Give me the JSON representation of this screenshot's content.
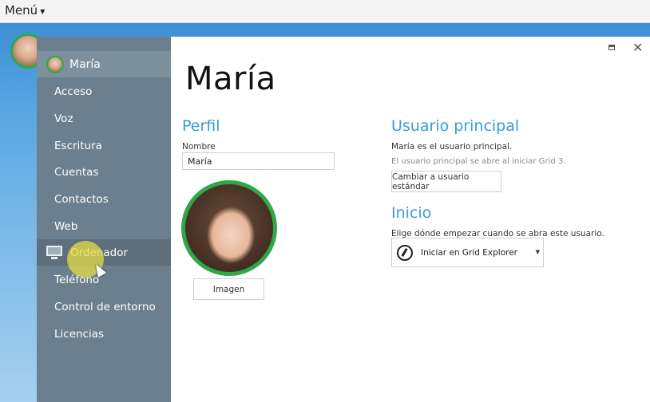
{
  "menubar": {
    "menu_label": "Menú"
  },
  "sidebar": {
    "user_name": "María",
    "items": [
      {
        "label": "Acceso"
      },
      {
        "label": "Voz"
      },
      {
        "label": "Escritura"
      },
      {
        "label": "Cuentas"
      },
      {
        "label": "Contactos"
      },
      {
        "label": "Web"
      },
      {
        "label": "Ordenador",
        "icon": "monitor-icon",
        "active": true
      },
      {
        "label": "Teléfono"
      },
      {
        "label": "Control de entorno"
      },
      {
        "label": "Licencias"
      }
    ]
  },
  "panel": {
    "title": "María",
    "profile": {
      "heading": "Perfil",
      "name_label": "Nombre",
      "name_value": "María",
      "image_button": "Imagen"
    },
    "main_user": {
      "heading": "Usuario principal",
      "status": "María es el usuario principal.",
      "note": "El usuario principal se abre al iniciar Grid 3.",
      "change_button": "Cambiar a usuario estándar"
    },
    "start": {
      "heading": "Inicio",
      "description": "Elige dónde empezar cuando se abra este usuario.",
      "selected_option": "Iniciar en Grid Explorer"
    }
  },
  "colors": {
    "accent": "#3a9bd5",
    "sidebar": "#6b7f8e",
    "avatar_ring": "#2fa84a"
  }
}
